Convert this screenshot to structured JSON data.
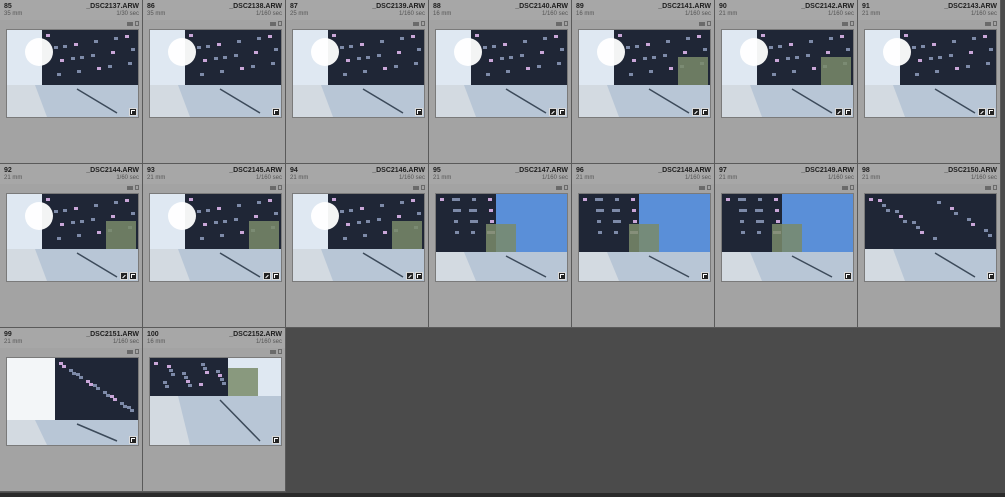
{
  "grid": {
    "cells": [
      {
        "idx": "85",
        "name": "_DSC2137.ARW",
        "focal": "35 mm",
        "shutter": "1/30 sec",
        "scene": "sunbox",
        "badges": [
          "crop"
        ]
      },
      {
        "idx": "86",
        "name": "_DSC2138.ARW",
        "focal": "35 mm",
        "shutter": "1/160 sec",
        "scene": "sunbox",
        "badges": [
          "crop"
        ]
      },
      {
        "idx": "87",
        "name": "_DSC2139.ARW",
        "focal": "25 mm",
        "shutter": "1/160 sec",
        "scene": "sunbox",
        "badges": [
          "crop"
        ]
      },
      {
        "idx": "88",
        "name": "_DSC2140.ARW",
        "focal": "16 mm",
        "shutter": "1/160 sec",
        "scene": "sunboxwide",
        "badges": [
          "edit",
          "crop"
        ]
      },
      {
        "idx": "89",
        "name": "_DSC2141.ARW",
        "focal": "16 mm",
        "shutter": "1/160 sec",
        "scene": "sunglass",
        "badges": [
          "edit",
          "crop"
        ]
      },
      {
        "idx": "90",
        "name": "_DSC2142.ARW",
        "focal": "21 mm",
        "shutter": "1/160 sec",
        "scene": "sunglass",
        "badges": [
          "edit",
          "crop"
        ]
      },
      {
        "idx": "91",
        "name": "_DSC2143.ARW",
        "focal": "21 mm",
        "shutter": "1/160 sec",
        "scene": "sunbox",
        "badges": [
          "edit",
          "crop"
        ]
      },
      {
        "idx": "92",
        "name": "_DSC2144.ARW",
        "focal": "21 mm",
        "shutter": "1/60 sec",
        "scene": "sunglass",
        "badges": [
          "edit",
          "crop"
        ]
      },
      {
        "idx": "93",
        "name": "_DSC2145.ARW",
        "focal": "21 mm",
        "shutter": "1/160 sec",
        "scene": "sunglass",
        "badges": [
          "edit",
          "crop"
        ]
      },
      {
        "idx": "94",
        "name": "_DSC2146.ARW",
        "focal": "21 mm",
        "shutter": "1/160 sec",
        "scene": "sunglass",
        "badges": [
          "edit",
          "crop"
        ]
      },
      {
        "idx": "95",
        "name": "_DSC2147.ARW",
        "focal": "21 mm",
        "shutter": "1/160 sec",
        "scene": "bluesky",
        "badges": [
          "crop"
        ]
      },
      {
        "idx": "96",
        "name": "_DSC2148.ARW",
        "focal": "21 mm",
        "shutter": "1/160 sec",
        "scene": "bluesky",
        "badges": [
          "crop"
        ]
      },
      {
        "idx": "97",
        "name": "_DSC2149.ARW",
        "focal": "21 mm",
        "shutter": "1/160 sec",
        "scene": "bluesky",
        "badges": [
          "crop"
        ]
      },
      {
        "idx": "98",
        "name": "_DSC2150.ARW",
        "focal": "21 mm",
        "shutter": "1/160 sec",
        "scene": "facade",
        "badges": [
          "crop"
        ]
      },
      {
        "idx": "99",
        "name": "_DSC2151.ARW",
        "focal": "21 mm",
        "shutter": "1/160 sec",
        "scene": "whitesky",
        "badges": [
          "crop"
        ]
      },
      {
        "idx": "100",
        "name": "_DSC2152.ARW",
        "focal": "16 mm",
        "shutter": "1/160 sec",
        "scene": "courtyard",
        "badges": [
          "crop"
        ]
      }
    ]
  },
  "colors": {
    "cell_bg": "#a3a3a3",
    "empty_bg": "#4b4b4b",
    "building": "#1f2636",
    "pavement": "#b8c6d6",
    "sky_blue": "#5a8fd8"
  },
  "icons": {
    "flag": "flag-icon",
    "metadata": "metadata-icon",
    "more": "more-dots-icon",
    "edit_badge": "develop-edit-icon",
    "crop_badge": "crop-icon"
  }
}
